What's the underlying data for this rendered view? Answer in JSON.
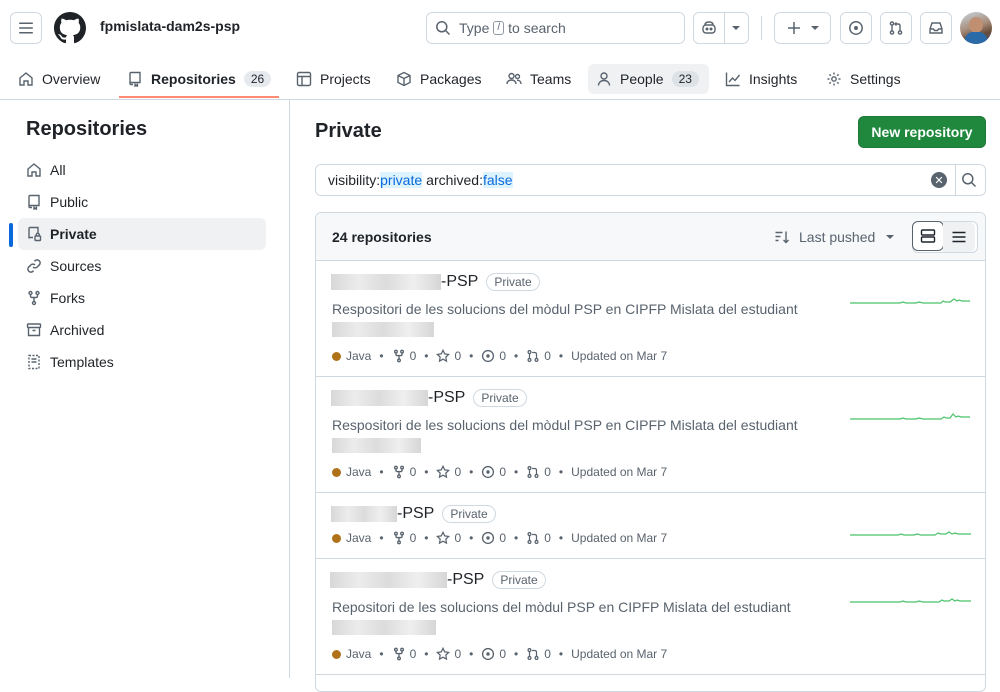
{
  "header": {
    "org": "fpmislata-dam2s-psp",
    "search_type": "Type",
    "search_key": "/",
    "search_suffix": "to search"
  },
  "nav": {
    "tabs": [
      {
        "label": "Overview"
      },
      {
        "label": "Repositories",
        "count": "26"
      },
      {
        "label": "Projects"
      },
      {
        "label": "Packages"
      },
      {
        "label": "Teams"
      },
      {
        "label": "People",
        "count": "23"
      },
      {
        "label": "Insights"
      },
      {
        "label": "Settings"
      }
    ]
  },
  "sidebar": {
    "title": "Repositories",
    "items": [
      {
        "label": "All",
        "icon": "home-icon"
      },
      {
        "label": "Public",
        "icon": "repo-icon"
      },
      {
        "label": "Private",
        "icon": "repo-locked-icon"
      },
      {
        "label": "Sources",
        "icon": "link-icon"
      },
      {
        "label": "Forks",
        "icon": "fork-icon"
      },
      {
        "label": "Archived",
        "icon": "archive-icon"
      },
      {
        "label": "Templates",
        "icon": "template-icon"
      }
    ],
    "active": "Private"
  },
  "main": {
    "title": "Private",
    "new_button": "New repository",
    "filter": {
      "k1": "visibility:",
      "v1": "private",
      "k2": "archived:",
      "v2": "false"
    },
    "count": "24 repositories",
    "sort": "Last pushed",
    "colors": {
      "java": "#b07219",
      "spark": "#4ac26b",
      "primary": "#1f883d"
    },
    "repos": [
      {
        "suffix": "-PSP",
        "badge": "Private",
        "desc": "Respositori de les solucions del mòdul PSP en CIPFP Mislata del estudiant",
        "lang": "Java",
        "forks": "0",
        "stars": "0",
        "issues": "0",
        "prs": "0",
        "updated": "Updated on Mar 7"
      },
      {
        "suffix": "-PSP",
        "badge": "Private",
        "desc": "Respositori de les solucions del mòdul PSP en CIPFP Mislata del estudiant",
        "lang": "Java",
        "forks": "0",
        "stars": "0",
        "issues": "0",
        "prs": "0",
        "updated": "Updated on Mar 7"
      },
      {
        "suffix": "-PSP",
        "badge": "Private",
        "desc": "",
        "lang": "Java",
        "forks": "0",
        "stars": "0",
        "issues": "0",
        "prs": "0",
        "updated": "Updated on Mar 7"
      },
      {
        "suffix": "-PSP",
        "badge": "Private",
        "desc": "Repositori de les solucions del mòdul PSP en CIPFP Mislata del estudiant",
        "lang": "Java",
        "forks": "0",
        "stars": "0",
        "issues": "0",
        "prs": "0",
        "updated": "Updated on Mar 7"
      }
    ]
  }
}
